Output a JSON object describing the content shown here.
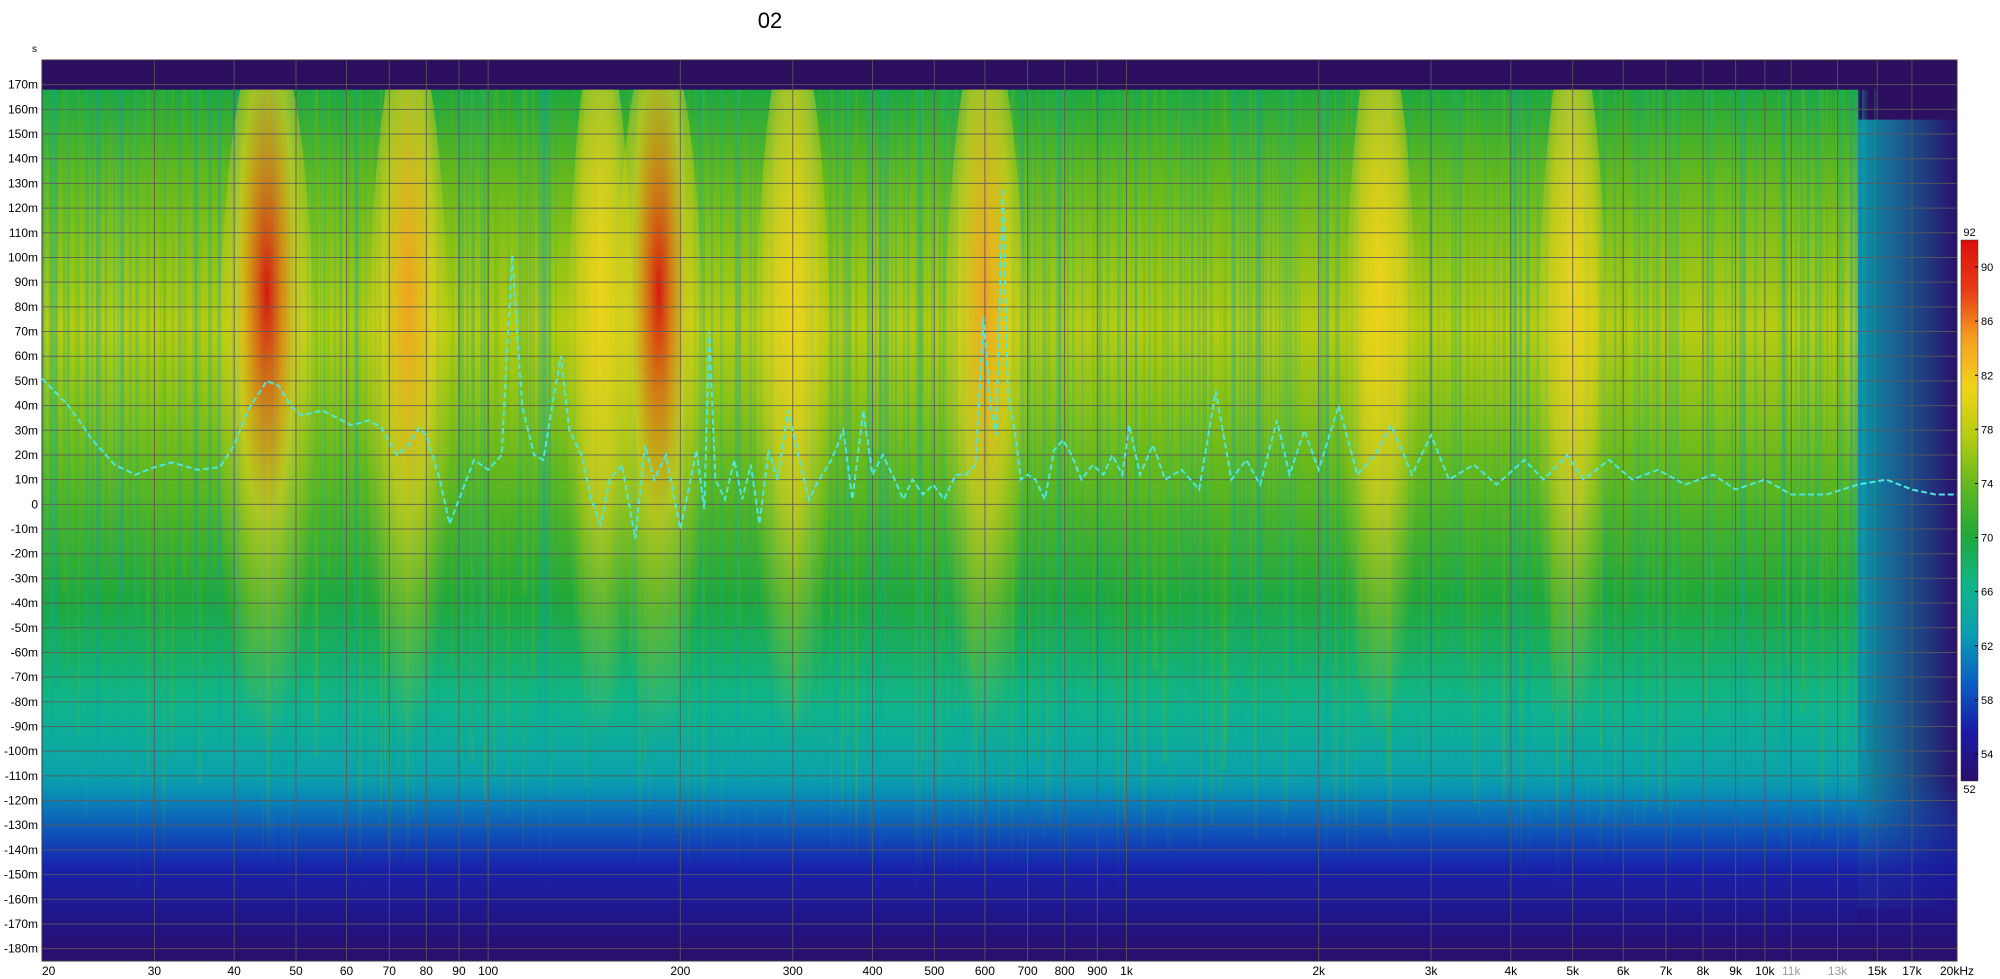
{
  "chart_data": {
    "type": "heatmap",
    "title": "02",
    "y_unit_label": "s",
    "x_scale": "log",
    "y_scale": "linear",
    "xlim": [
      20,
      20000
    ],
    "ylim": [
      -0.185,
      0.18
    ],
    "grid": true,
    "x_ticks": [
      {
        "v": 20,
        "label": "20"
      },
      {
        "v": 30,
        "label": "30"
      },
      {
        "v": 40,
        "label": "40"
      },
      {
        "v": 50,
        "label": "50"
      },
      {
        "v": 60,
        "label": "60"
      },
      {
        "v": 70,
        "label": "70"
      },
      {
        "v": 80,
        "label": "80"
      },
      {
        "v": 90,
        "label": "90"
      },
      {
        "v": 100,
        "label": "100"
      },
      {
        "v": 200,
        "label": "200"
      },
      {
        "v": 300,
        "label": "300"
      },
      {
        "v": 400,
        "label": "400"
      },
      {
        "v": 500,
        "label": "500"
      },
      {
        "v": 600,
        "label": "600"
      },
      {
        "v": 700,
        "label": "700"
      },
      {
        "v": 800,
        "label": "800"
      },
      {
        "v": 900,
        "label": "900"
      },
      {
        "v": 1000,
        "label": "1k"
      },
      {
        "v": 2000,
        "label": "2k"
      },
      {
        "v": 3000,
        "label": "3k"
      },
      {
        "v": 4000,
        "label": "4k"
      },
      {
        "v": 5000,
        "label": "5k"
      },
      {
        "v": 6000,
        "label": "6k"
      },
      {
        "v": 7000,
        "label": "7k"
      },
      {
        "v": 8000,
        "label": "8k"
      },
      {
        "v": 9000,
        "label": "9k"
      },
      {
        "v": 10000,
        "label": "10k"
      },
      {
        "v": 11000,
        "label": "11k",
        "minor": true
      },
      {
        "v": 13000,
        "label": "13k",
        "minor": true
      },
      {
        "v": 15000,
        "label": "15k"
      },
      {
        "v": 17000,
        "label": "17k"
      },
      {
        "v": 20000,
        "label": "20kHz"
      }
    ],
    "y_ticks": [
      {
        "v": 0.17,
        "label": "170m"
      },
      {
        "v": 0.16,
        "label": "160m"
      },
      {
        "v": 0.15,
        "label": "150m"
      },
      {
        "v": 0.14,
        "label": "140m"
      },
      {
        "v": 0.13,
        "label": "130m"
      },
      {
        "v": 0.12,
        "label": "120m"
      },
      {
        "v": 0.11,
        "label": "110m"
      },
      {
        "v": 0.1,
        "label": "100m"
      },
      {
        "v": 0.09,
        "label": "90m"
      },
      {
        "v": 0.08,
        "label": "80m"
      },
      {
        "v": 0.07,
        "label": "70m"
      },
      {
        "v": 0.06,
        "label": "60m"
      },
      {
        "v": 0.05,
        "label": "50m"
      },
      {
        "v": 0.04,
        "label": "40m"
      },
      {
        "v": 0.03,
        "label": "30m"
      },
      {
        "v": 0.02,
        "label": "20m"
      },
      {
        "v": 0.01,
        "label": "10m"
      },
      {
        "v": 0.0,
        "label": "0"
      },
      {
        "v": -0.01,
        "label": "-10m"
      },
      {
        "v": -0.02,
        "label": "-20m"
      },
      {
        "v": -0.03,
        "label": "-30m"
      },
      {
        "v": -0.04,
        "label": "-40m"
      },
      {
        "v": -0.05,
        "label": "-50m"
      },
      {
        "v": -0.06,
        "label": "-60m"
      },
      {
        "v": -0.07,
        "label": "-70m"
      },
      {
        "v": -0.08,
        "label": "-80m"
      },
      {
        "v": -0.09,
        "label": "-90m"
      },
      {
        "v": -0.1,
        "label": "-100m"
      },
      {
        "v": -0.11,
        "label": "-110m"
      },
      {
        "v": -0.12,
        "label": "-120m"
      },
      {
        "v": -0.13,
        "label": "-130m"
      },
      {
        "v": -0.14,
        "label": "-140m"
      },
      {
        "v": -0.15,
        "label": "-150m"
      },
      {
        "v": -0.16,
        "label": "-160m"
      },
      {
        "v": -0.17,
        "label": "-170m"
      },
      {
        "v": -0.18,
        "label": "-180m"
      }
    ],
    "colorbar": {
      "min": 52,
      "max": 92,
      "min_label": "52",
      "max_label": "92",
      "tick_labels": [
        "90",
        "86",
        "82",
        "78",
        "74",
        "70",
        "66",
        "62",
        "58",
        "54"
      ],
      "tick_values": [
        90,
        86,
        82,
        78,
        74,
        70,
        66,
        62,
        58,
        54
      ],
      "colors": [
        "#2a0f6b",
        "#1a1aa6",
        "#0a5fc4",
        "#0a9fb0",
        "#10b58a",
        "#20a83a",
        "#63b81e",
        "#b6cc12",
        "#f0d41a",
        "#f5a020",
        "#e83a16",
        "#d8100e"
      ]
    },
    "plot_background": "#2d0f60",
    "peak_columns": [
      {
        "freq": 45,
        "intensity": 0.95
      },
      {
        "freq": 75,
        "intensity": 0.7
      },
      {
        "freq": 150,
        "intensity": 0.45
      },
      {
        "freq": 185,
        "intensity": 0.85
      },
      {
        "freq": 300,
        "intensity": 0.6
      },
      {
        "freq": 600,
        "intensity": 0.7
      },
      {
        "freq": 2500,
        "intensity": 0.55
      },
      {
        "freq": 5000,
        "intensity": 0.5
      }
    ],
    "series": [
      {
        "kind": "group_delay_overlay",
        "color": "#4fe6dc",
        "style": "dashed",
        "points": [
          [
            20,
            0.051
          ],
          [
            22,
            0.04
          ],
          [
            24,
            0.026
          ],
          [
            26,
            0.016
          ],
          [
            28,
            0.012
          ],
          [
            30,
            0.015
          ],
          [
            32,
            0.017
          ],
          [
            35,
            0.014
          ],
          [
            38,
            0.015
          ],
          [
            40,
            0.024
          ],
          [
            42,
            0.038
          ],
          [
            45,
            0.05
          ],
          [
            47,
            0.048
          ],
          [
            49,
            0.04
          ],
          [
            51,
            0.036
          ],
          [
            55,
            0.038
          ],
          [
            58,
            0.035
          ],
          [
            61,
            0.032
          ],
          [
            65,
            0.034
          ],
          [
            68,
            0.031
          ],
          [
            72,
            0.02
          ],
          [
            75,
            0.024
          ],
          [
            78,
            0.031
          ],
          [
            80,
            0.028
          ],
          [
            84,
            0.01
          ],
          [
            87,
            -0.008
          ],
          [
            90,
            0.002
          ],
          [
            95,
            0.018
          ],
          [
            100,
            0.014
          ],
          [
            105,
            0.02
          ],
          [
            109,
            0.101
          ],
          [
            113,
            0.04
          ],
          [
            118,
            0.02
          ],
          [
            122,
            0.018
          ],
          [
            126,
            0.04
          ],
          [
            130,
            0.06
          ],
          [
            134,
            0.03
          ],
          [
            140,
            0.02
          ],
          [
            145,
            0.002
          ],
          [
            150,
            -0.008
          ],
          [
            155,
            0.01
          ],
          [
            162,
            0.016
          ],
          [
            170,
            -0.014
          ],
          [
            176,
            0.024
          ],
          [
            182,
            0.01
          ],
          [
            190,
            0.02
          ],
          [
            200,
            -0.01
          ],
          [
            206,
            0.006
          ],
          [
            212,
            0.022
          ],
          [
            218,
            -0.002
          ],
          [
            222,
            0.07
          ],
          [
            227,
            0.01
          ],
          [
            235,
            0.002
          ],
          [
            243,
            0.018
          ],
          [
            250,
            0.002
          ],
          [
            258,
            0.016
          ],
          [
            266,
            -0.008
          ],
          [
            275,
            0.022
          ],
          [
            284,
            0.01
          ],
          [
            295,
            0.038
          ],
          [
            306,
            0.02
          ],
          [
            318,
            0.002
          ],
          [
            330,
            0.01
          ],
          [
            345,
            0.018
          ],
          [
            360,
            0.03
          ],
          [
            372,
            0.002
          ],
          [
            387,
            0.038
          ],
          [
            400,
            0.012
          ],
          [
            415,
            0.02
          ],
          [
            430,
            0.012
          ],
          [
            447,
            0.002
          ],
          [
            462,
            0.01
          ],
          [
            480,
            0.004
          ],
          [
            498,
            0.008
          ],
          [
            518,
            0.002
          ],
          [
            540,
            0.012
          ],
          [
            560,
            0.012
          ],
          [
            580,
            0.016
          ],
          [
            597,
            0.076
          ],
          [
            612,
            0.04
          ],
          [
            625,
            0.028
          ],
          [
            640,
            0.128
          ],
          [
            652,
            0.045
          ],
          [
            668,
            0.03
          ],
          [
            683,
            0.01
          ],
          [
            700,
            0.012
          ],
          [
            720,
            0.01
          ],
          [
            745,
            0.002
          ],
          [
            770,
            0.022
          ],
          [
            795,
            0.026
          ],
          [
            820,
            0.02
          ],
          [
            850,
            0.01
          ],
          [
            885,
            0.016
          ],
          [
            920,
            0.012
          ],
          [
            950,
            0.02
          ],
          [
            985,
            0.012
          ],
          [
            1010,
            0.032
          ],
          [
            1050,
            0.012
          ],
          [
            1100,
            0.024
          ],
          [
            1150,
            0.01
          ],
          [
            1220,
            0.014
          ],
          [
            1300,
            0.006
          ],
          [
            1380,
            0.046
          ],
          [
            1460,
            0.01
          ],
          [
            1540,
            0.018
          ],
          [
            1620,
            0.008
          ],
          [
            1720,
            0.034
          ],
          [
            1800,
            0.012
          ],
          [
            1900,
            0.03
          ],
          [
            2000,
            0.014
          ],
          [
            2150,
            0.04
          ],
          [
            2300,
            0.012
          ],
          [
            2450,
            0.02
          ],
          [
            2600,
            0.032
          ],
          [
            2800,
            0.012
          ],
          [
            3000,
            0.028
          ],
          [
            3200,
            0.01
          ],
          [
            3500,
            0.016
          ],
          [
            3800,
            0.008
          ],
          [
            4200,
            0.018
          ],
          [
            4500,
            0.01
          ],
          [
            4900,
            0.02
          ],
          [
            5200,
            0.01
          ],
          [
            5700,
            0.018
          ],
          [
            6200,
            0.01
          ],
          [
            6800,
            0.014
          ],
          [
            7500,
            0.008
          ],
          [
            8300,
            0.012
          ],
          [
            9000,
            0.006
          ],
          [
            10000,
            0.01
          ],
          [
            11000,
            0.004
          ],
          [
            12500,
            0.004
          ],
          [
            14000,
            0.008
          ],
          [
            15500,
            0.01
          ],
          [
            17000,
            0.006
          ],
          [
            18500,
            0.004
          ],
          [
            20000,
            0.004
          ]
        ]
      }
    ]
  }
}
